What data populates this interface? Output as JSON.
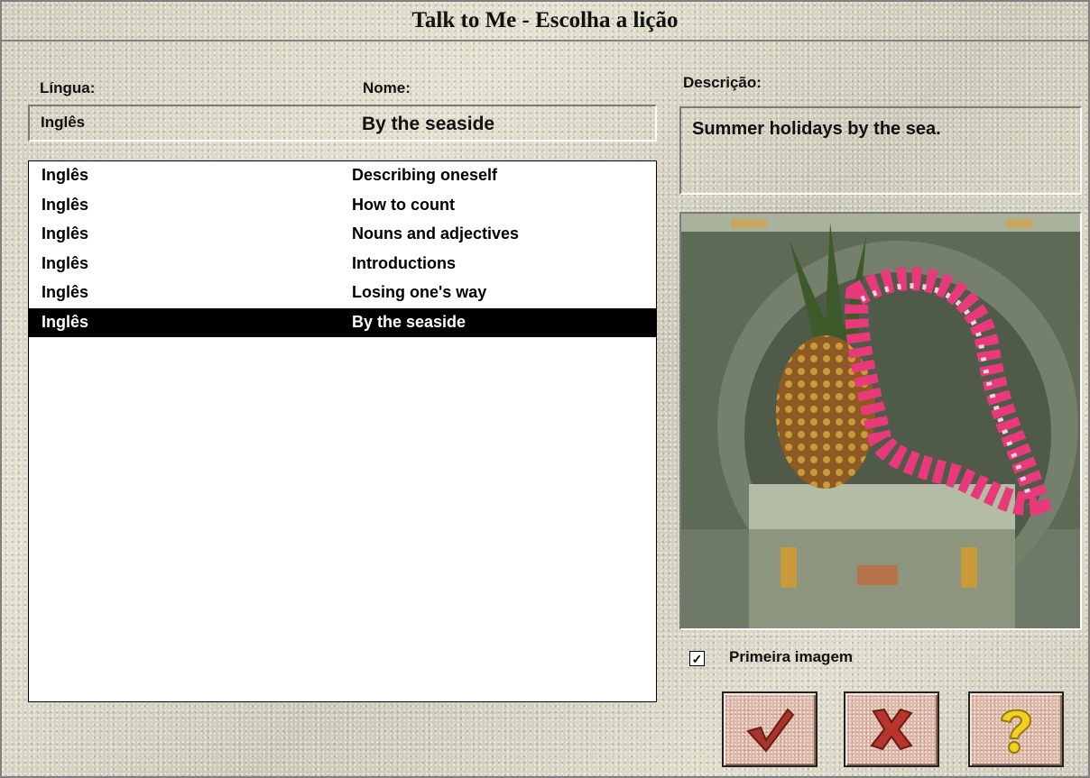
{
  "window": {
    "title": "Talk to Me - Escolha a lição"
  },
  "labels": {
    "lingua": "Língua:",
    "nome": "Nome:",
    "descricao": "Descrição:"
  },
  "current": {
    "lingua": "Inglês",
    "nome": "By the seaside",
    "descricao": "Summer holidays by the sea."
  },
  "lessons": [
    {
      "lingua": "Inglês",
      "nome": "Describing oneself",
      "selected": false
    },
    {
      "lingua": "Inglês",
      "nome": "How to count",
      "selected": false
    },
    {
      "lingua": "Inglês",
      "nome": "Nouns and adjectives",
      "selected": false
    },
    {
      "lingua": "Inglês",
      "nome": "Introductions",
      "selected": false
    },
    {
      "lingua": "Inglês",
      "nome": "Losing one's way",
      "selected": false
    },
    {
      "lingua": "Inglês",
      "nome": "By the seaside",
      "selected": true
    }
  ],
  "checkbox": {
    "label": "Primeira imagem",
    "checked": true,
    "mark": "✓"
  },
  "buttons": {
    "ok_icon": "checkmark-icon",
    "cancel_icon": "cross-icon",
    "help_icon": "question-icon"
  },
  "colors": {
    "ok": "#a8342c",
    "cancel": "#b8342c",
    "help": "#f0d020",
    "selection": "#000000"
  }
}
